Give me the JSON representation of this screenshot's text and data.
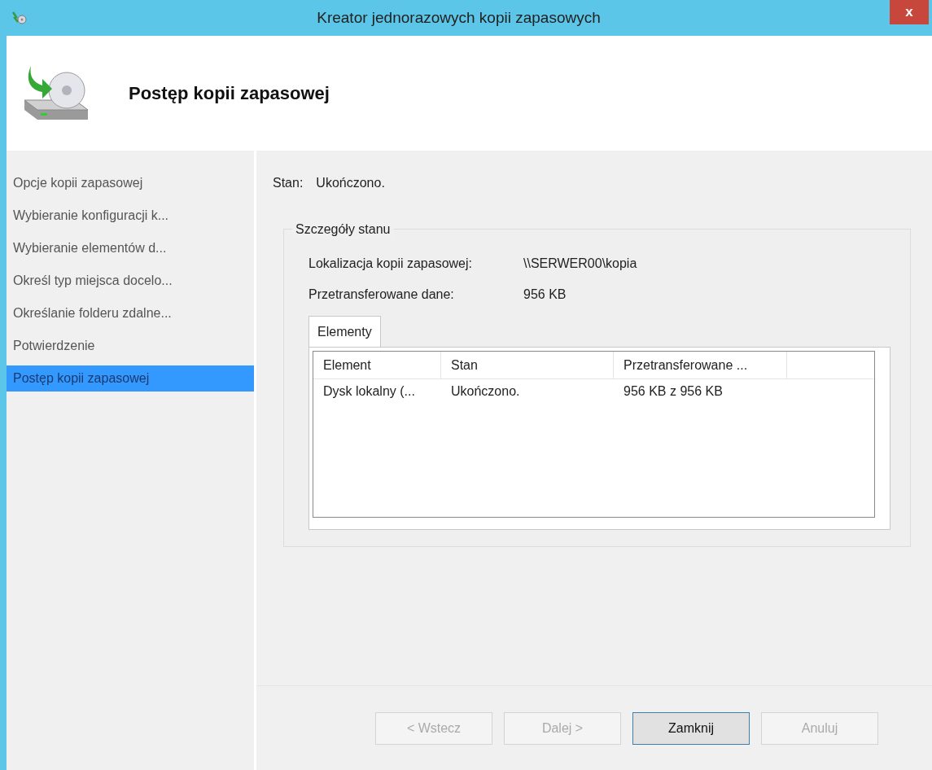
{
  "window": {
    "title": "Kreator jednorazowych kopii zapasowych",
    "close": "x"
  },
  "header": {
    "title": "Postęp kopii zapasowej"
  },
  "sidebar": {
    "items": [
      {
        "label": "Opcje kopii zapasowej",
        "selected": false
      },
      {
        "label": "Wybieranie konfiguracji k...",
        "selected": false
      },
      {
        "label": "Wybieranie elementów d...",
        "selected": false
      },
      {
        "label": "Określ typ miejsca docelo...",
        "selected": false
      },
      {
        "label": "Określanie folderu zdalne...",
        "selected": false
      },
      {
        "label": "Potwierdzenie",
        "selected": false
      },
      {
        "label": "Postęp kopii zapasowej",
        "selected": true
      }
    ]
  },
  "status": {
    "label": "Stan:",
    "value": "Ukończono."
  },
  "details": {
    "title": "Szczegóły stanu",
    "fields": [
      {
        "label": "Lokalizacja kopii zapasowej:",
        "value": "\\\\SERWER00\\kopia"
      },
      {
        "label": "Przetransferowane dane:",
        "value": "956 KB"
      }
    ],
    "tabs": [
      {
        "label": "Elementy",
        "selected": true
      }
    ],
    "table": {
      "columns": [
        "Element",
        "Stan",
        "Przetransferowane ..."
      ],
      "rows": [
        [
          "Dysk lokalny (...",
          "Ukończono.",
          "956 KB z 956 KB"
        ]
      ]
    }
  },
  "buttons": [
    {
      "label": "< Wstecz",
      "disabled": true,
      "default": false
    },
    {
      "label": "Dalej >",
      "disabled": true,
      "default": false
    },
    {
      "label": "Zamknij",
      "disabled": false,
      "default": true
    },
    {
      "label": "Anuluj",
      "disabled": true,
      "default": false
    }
  ]
}
